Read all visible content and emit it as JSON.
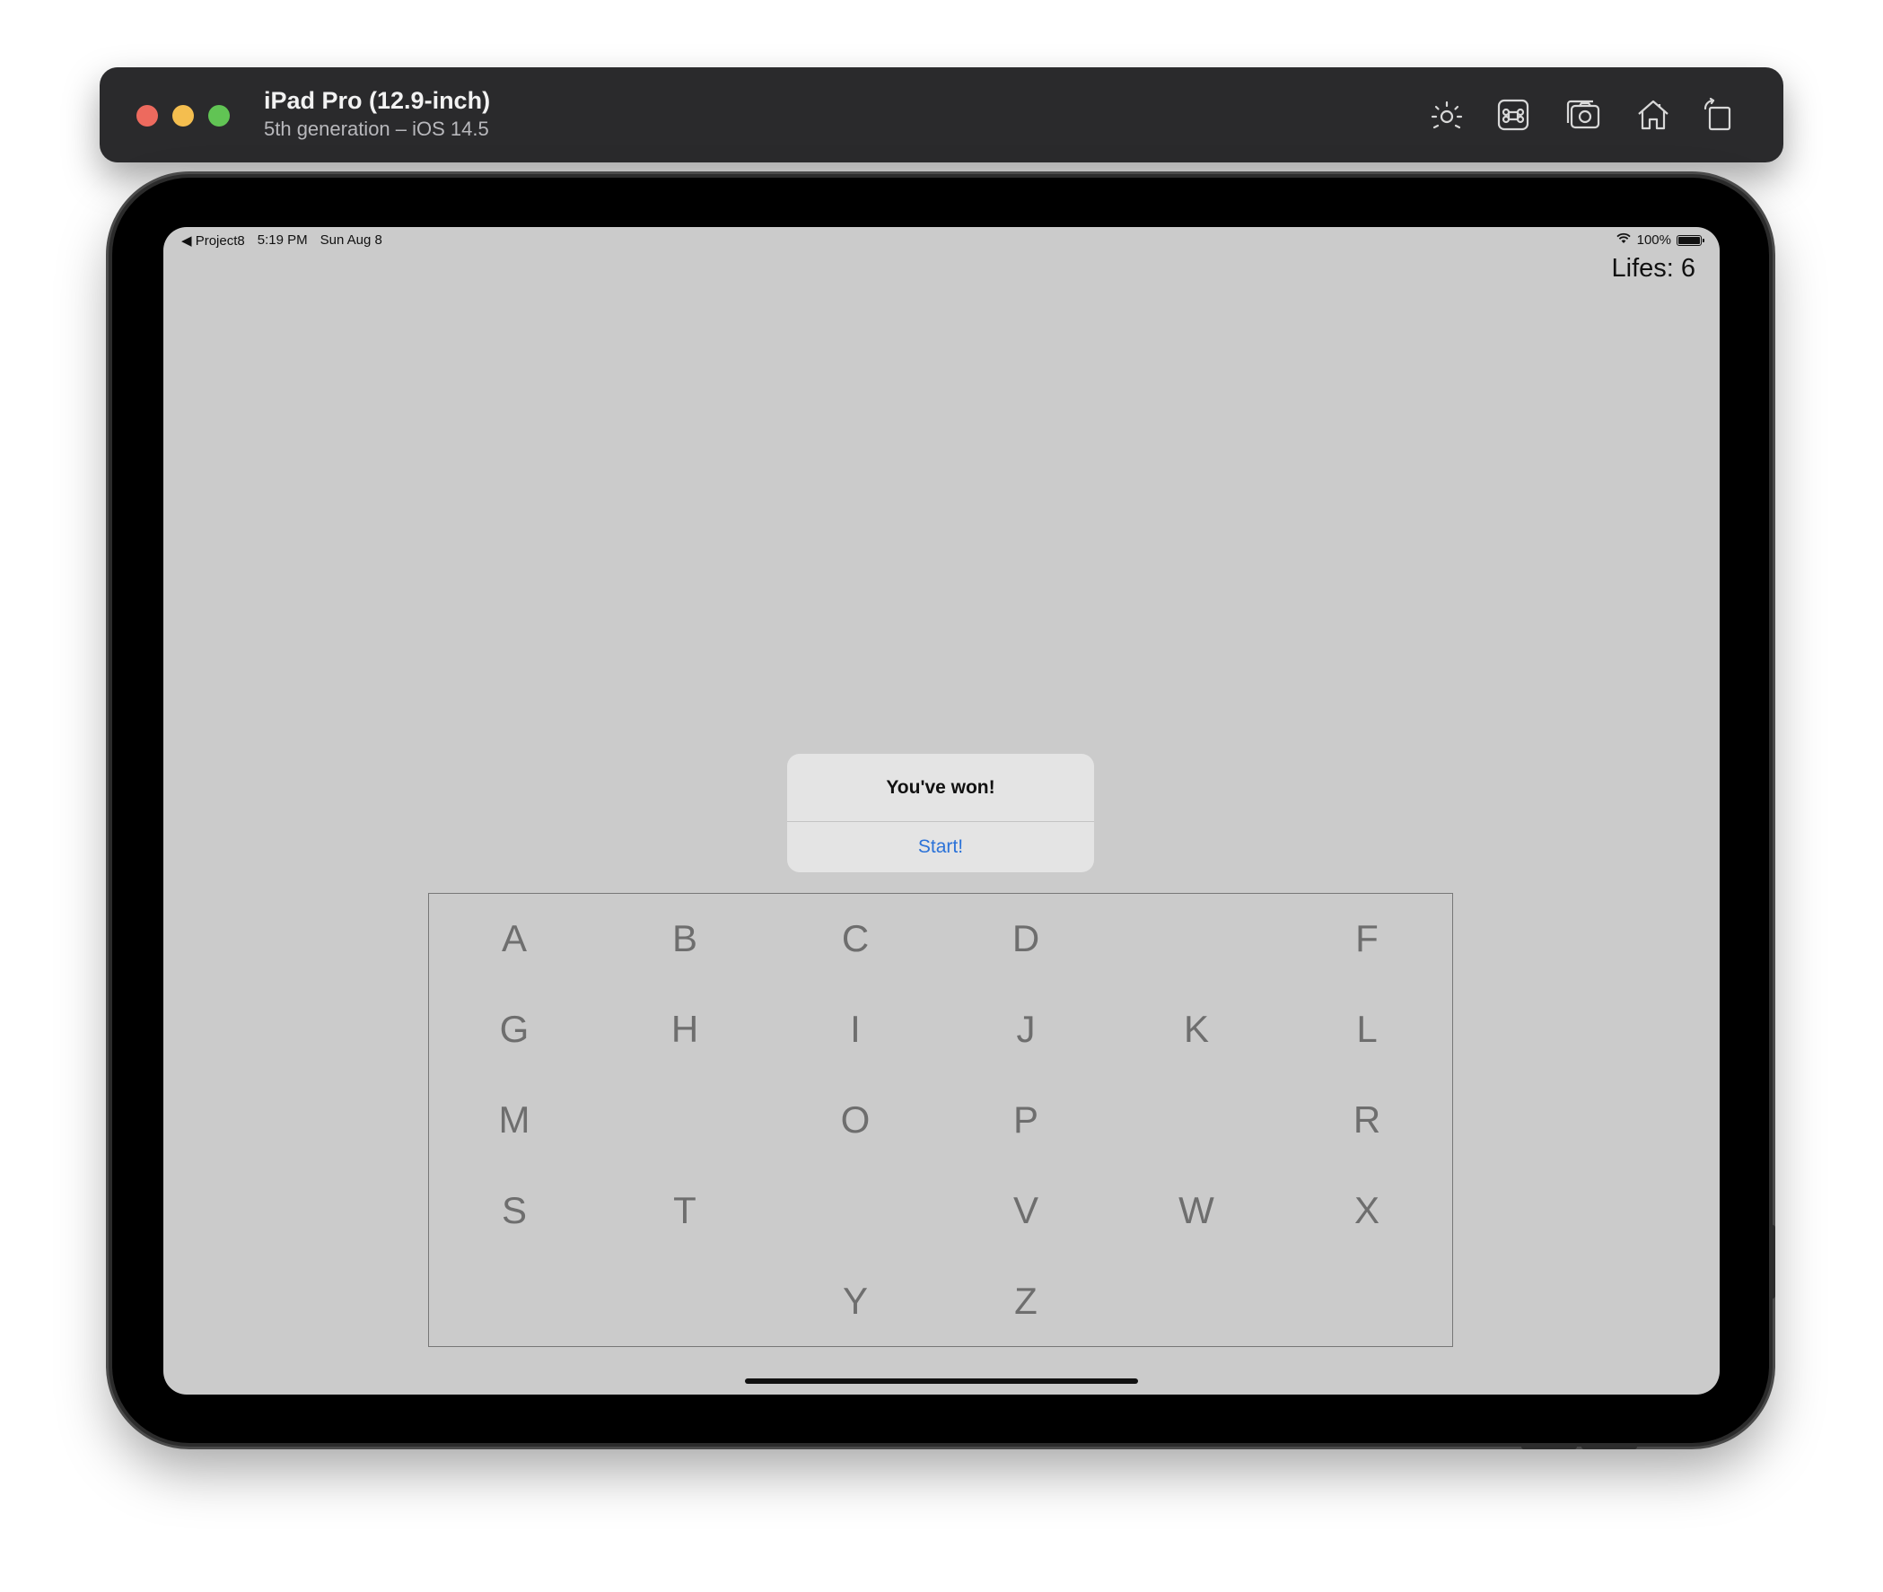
{
  "window": {
    "title": "iPad Pro (12.9-inch)",
    "subtitle": "5th generation – iOS 14.5",
    "toolbar_icons": [
      "brightness-icon",
      "command-key-icon",
      "screenshot-icon",
      "home-icon",
      "rotate-icon"
    ]
  },
  "status_bar": {
    "back_app": "◀ Project8",
    "time": "5:19 PM",
    "date": "Sun Aug 8",
    "battery": "100%"
  },
  "game": {
    "lifes_label": "Lifes: 6"
  },
  "alert": {
    "title": "You've won!",
    "action": "Start!"
  },
  "keyboard": {
    "letters": [
      "A",
      "B",
      "C",
      "D",
      "",
      "F",
      "G",
      "H",
      "I",
      "J",
      "K",
      "L",
      "M",
      "",
      "O",
      "P",
      "",
      "R",
      "S",
      "T",
      "",
      "V",
      "W",
      "X",
      "",
      "",
      "Y",
      "Z",
      "",
      ""
    ]
  },
  "colors": {
    "screen_background": "#cbcbcb",
    "alert_action": "#2b72d8",
    "letter_text": "#6e6e6e"
  }
}
